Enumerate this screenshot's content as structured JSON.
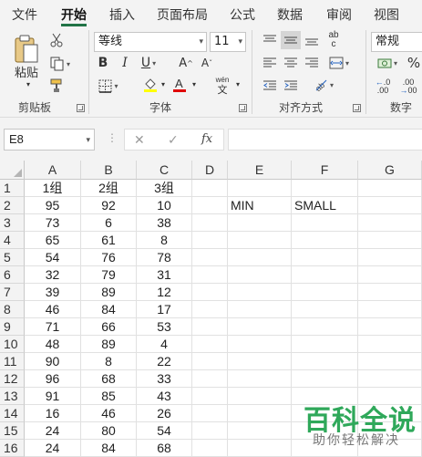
{
  "tabs": [
    {
      "label": "文件",
      "active": false
    },
    {
      "label": "开始",
      "active": true
    },
    {
      "label": "插入",
      "active": false
    },
    {
      "label": "页面布局",
      "active": false
    },
    {
      "label": "公式",
      "active": false
    },
    {
      "label": "数据",
      "active": false
    },
    {
      "label": "审阅",
      "active": false
    },
    {
      "label": "视图",
      "active": false
    }
  ],
  "ribbon": {
    "clipboard": {
      "paste_label": "粘贴",
      "group_label": "剪贴板"
    },
    "font": {
      "font_name": "等线",
      "font_size": "11",
      "group_label": "字体",
      "wen_label": "wén",
      "wen_char": "文",
      "highlight_color": "#ffff00",
      "font_color": "#e00000"
    },
    "alignment": {
      "group_label": "对齐方式",
      "ab_label": "ab",
      "c_label": "c"
    },
    "number": {
      "format": "常规",
      "group_label": "数字",
      "percent": "%",
      "dec_up": ".00",
      "dec_down": ".0",
      "dec_arrow_up": "←",
      "dec_arrow_down": "→",
      "dec_down_prefix": "00"
    }
  },
  "formula_bar": {
    "name_box": "E8",
    "cancel": "✕",
    "enter": "✓",
    "fx": "fx",
    "formula": ""
  },
  "columns": [
    "A",
    "B",
    "C",
    "D",
    "E",
    "F",
    "G"
  ],
  "rows": [
    [
      "1组",
      "2组",
      "3组",
      "",
      "",
      "",
      ""
    ],
    [
      "95",
      "92",
      "10",
      "",
      "MIN",
      "SMALL",
      ""
    ],
    [
      "73",
      "6",
      "38",
      "",
      "",
      "",
      ""
    ],
    [
      "65",
      "61",
      "8",
      "",
      "",
      "",
      ""
    ],
    [
      "54",
      "76",
      "78",
      "",
      "",
      "",
      ""
    ],
    [
      "32",
      "79",
      "31",
      "",
      "",
      "",
      ""
    ],
    [
      "39",
      "89",
      "12",
      "",
      "",
      "",
      ""
    ],
    [
      "46",
      "84",
      "17",
      "",
      "",
      "",
      ""
    ],
    [
      "71",
      "66",
      "53",
      "",
      "",
      "",
      ""
    ],
    [
      "48",
      "89",
      "4",
      "",
      "",
      "",
      ""
    ],
    [
      "90",
      "8",
      "22",
      "",
      "",
      "",
      ""
    ],
    [
      "96",
      "68",
      "33",
      "",
      "",
      "",
      ""
    ],
    [
      "91",
      "85",
      "43",
      "",
      "",
      "",
      ""
    ],
    [
      "16",
      "46",
      "26",
      "",
      "",
      "",
      ""
    ],
    [
      "24",
      "80",
      "54",
      "",
      "",
      "",
      ""
    ],
    [
      "24",
      "84",
      "68",
      "",
      "",
      "",
      ""
    ]
  ],
  "row_numbers": [
    "1",
    "2",
    "3",
    "4",
    "5",
    "6",
    "7",
    "8",
    "9",
    "10",
    "11",
    "12",
    "13",
    "14",
    "15",
    "16"
  ],
  "watermark": {
    "title": "百科全说",
    "subtitle": "助你轻松解决"
  },
  "colors": {
    "accent": "#217346",
    "watermark": "#2fa85a"
  }
}
